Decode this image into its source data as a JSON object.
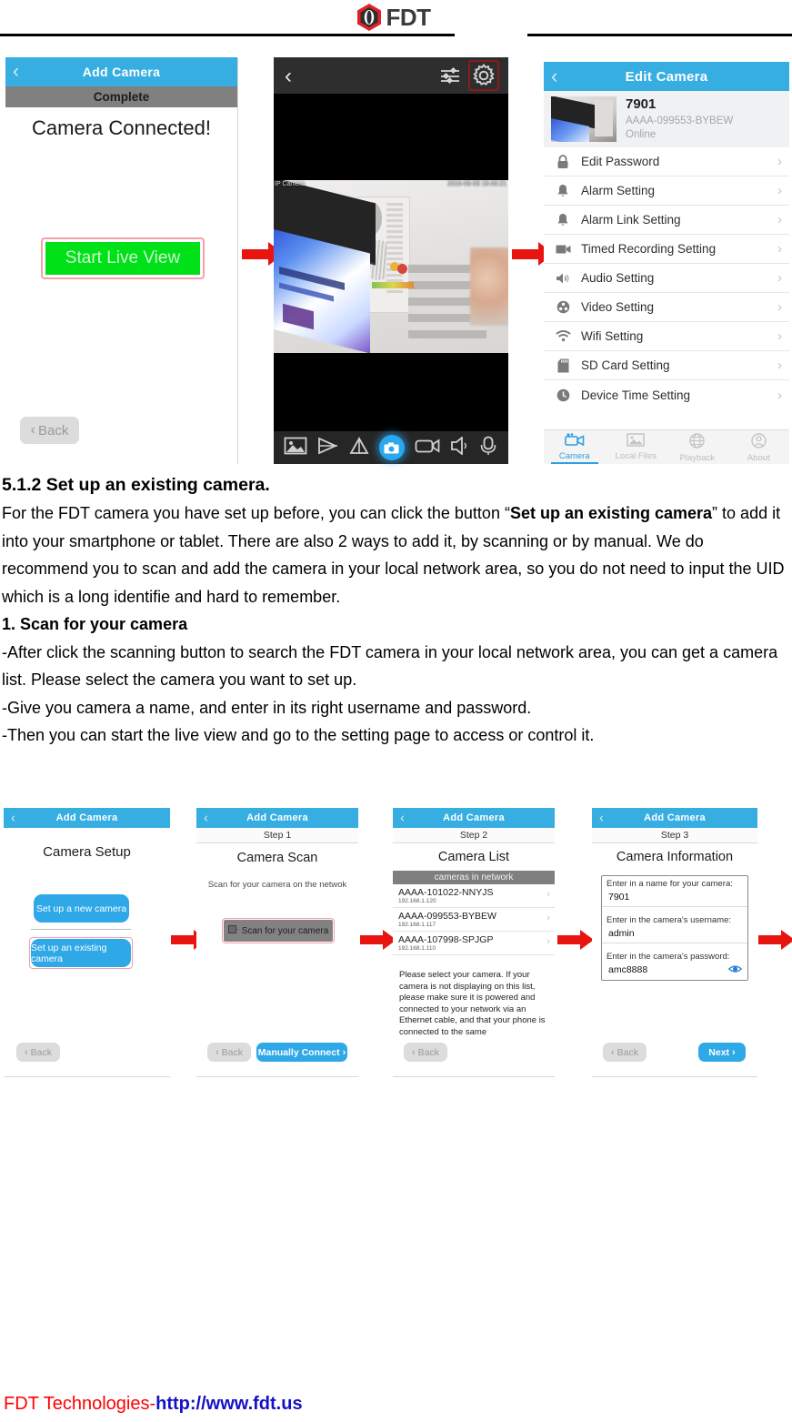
{
  "brand": {
    "name": "FDT",
    "logo_icon": "fdt-hex-logo"
  },
  "section": {
    "heading": "5.1.2 Set up an existing camera.",
    "paragraph_parts": [
      {
        "t": "For the FDT camera you have set up before, you can click the button “",
        "b": false
      },
      {
        "t": "Set up an existing camera",
        "b": true
      },
      {
        "t": "” to add it into your smartphone or tablet. There are also 2 ways to add it, by scanning or by manual. We do recommend you to scan and add the camera in your local network area, so you do not need to input the UID which is a long identifie and hard to remember.",
        "b": false
      }
    ],
    "sub_heading": "1. Scan for your camera",
    "bullets": [
      "-After click the scanning button to search the FDT camera in your local network area, you can get a camera list. Please select the camera you want to set up.",
      "-Give you camera a name, and enter in its right username and password.",
      "-Then you can start the live view and go to the setting page to access or control it."
    ]
  },
  "colors": {
    "nav_blue": "#37aee2",
    "button_blue": "#2fa8e8",
    "arrow_red": "#e8140f",
    "highlight_pink": "#f4a0a8",
    "green_button": "#00e118",
    "grey_subbar": "#808080",
    "footer_red": "#ff0000",
    "footer_blue": "#1410c8"
  },
  "shot_complete": {
    "nav_title": "Add Camera",
    "back_chevron_icon": "chevron-left-icon",
    "subbar": "Complete",
    "message": "Camera Connected!",
    "primary_button": "Start Live View",
    "back_button": "Back",
    "back_button_icon": "chevron-left-icon"
  },
  "shot_liveview": {
    "back_chevron_icon": "chevron-left-icon",
    "sliders_icon": "sliders-icon",
    "gear_icon": "gear-icon",
    "osd_left": "IP Camera",
    "osd_right": "2016-09-08 19:46:21",
    "toolbar_icons": [
      "photo-icon",
      "flip-horizontal-icon",
      "flip-vertical-icon",
      "snapshot-camera-icon",
      "video-record-icon",
      "speaker-icon",
      "microphone-icon"
    ]
  },
  "shot_edit_camera": {
    "nav_title": "Edit Camera",
    "back_chevron_icon": "chevron-left-icon",
    "thumbnail_icon": "camera-thumbnail",
    "camera_name": "7901",
    "camera_uid": "AAAA-099553-BYBEW",
    "camera_status": "Online",
    "rows": [
      {
        "label": "Edit Password",
        "icon": "lock-icon"
      },
      {
        "label": "Alarm Setting",
        "icon": "bell-icon"
      },
      {
        "label": "Alarm Link Setting",
        "icon": "bell-icon"
      },
      {
        "label": "Timed Recording Setting",
        "icon": "video-camera-icon"
      },
      {
        "label": "Audio Setting",
        "icon": "speaker-icon"
      },
      {
        "label": "Video Setting",
        "icon": "video-reel-icon"
      },
      {
        "label": "Wifi Setting",
        "icon": "wifi-icon"
      },
      {
        "label": "SD Card Setting",
        "icon": "sd-card-icon"
      },
      {
        "label": "Device Time Setting",
        "icon": "clock-icon"
      }
    ],
    "row_arrow_icon": "chevron-right-icon",
    "tabs": [
      {
        "label": "Camera",
        "icon": "camera-tab-icon",
        "active": true
      },
      {
        "label": "Local Files",
        "icon": "pictures-tab-icon",
        "active": false
      },
      {
        "label": "Playback",
        "icon": "globe-tab-icon",
        "active": false
      },
      {
        "label": "About",
        "icon": "person-tab-icon",
        "active": false
      }
    ]
  },
  "shot_setup": {
    "nav_title": "Add Camera",
    "back_chevron_icon": "chevron-left-icon",
    "title": "Camera Setup",
    "button_new": "Set up a new camera",
    "button_existing": "Set up an existing camera",
    "back_button": "Back",
    "back_button_icon": "chevron-left-icon"
  },
  "shot_scan": {
    "nav_title": "Add Camera",
    "back_chevron_icon": "chevron-left-icon",
    "step": "Step 1",
    "title": "Camera Scan",
    "hint": "Scan for your camera on the netwok",
    "scan_button": "Scan for your camera",
    "scan_button_icon": "scan-icon",
    "back_button": "Back",
    "back_button_icon": "chevron-left-icon",
    "next_button": "Manually Connect",
    "next_button_icon": "chevron-right-icon"
  },
  "shot_list": {
    "nav_title": "Add Camera",
    "back_chevron_icon": "chevron-left-icon",
    "step": "Step 2",
    "title": "Camera List",
    "list_header": "cameras in network",
    "cameras": [
      {
        "uid": "AAAA-101022-NNYJS",
        "ip": "192.168.1.120"
      },
      {
        "uid": "AAAA-099553-BYBEW",
        "ip": "192.168.1.117"
      },
      {
        "uid": "AAAA-107998-SPJGP",
        "ip": "192.168.1.110"
      }
    ],
    "row_arrow_icon": "chevron-right-icon",
    "note": "Please select your camera. If your camera is not displaying on this list, please make sure it is powered and connected to your network via an Ethernet cable, and that your phone is connected to the same",
    "back_button": "Back",
    "back_button_icon": "chevron-left-icon"
  },
  "shot_info": {
    "nav_title": "Add Camera",
    "back_chevron_icon": "chevron-left-icon",
    "step": "Step 3",
    "title": "Camera Information",
    "fields": [
      {
        "label": "Enter in a name for your camera:",
        "value": "7901"
      },
      {
        "label": "Enter in the camera's username:",
        "value": "admin"
      },
      {
        "label": "Enter in the camera's password:",
        "value": "amc8888"
      }
    ],
    "reveal_icon": "eye-icon",
    "back_button": "Back",
    "back_button_icon": "chevron-left-icon",
    "next_button": "Next",
    "next_button_icon": "chevron-right-icon"
  },
  "footer": {
    "company": "FDT Technologies-",
    "url": "http://www.fdt.us"
  }
}
